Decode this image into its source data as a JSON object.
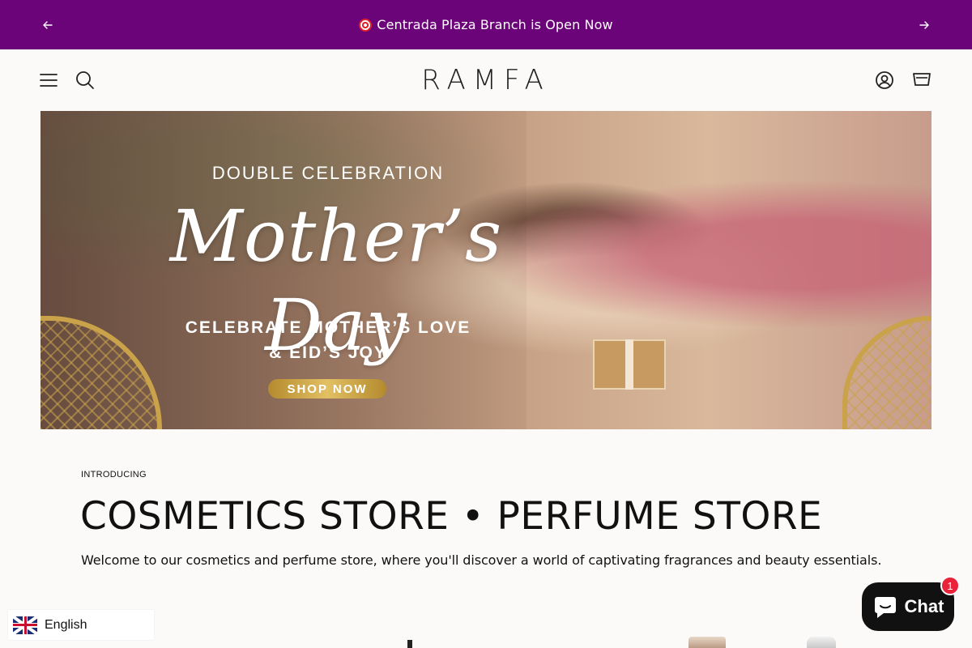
{
  "announcement": {
    "text": "Centrada Plaza Branch is Open Now",
    "icon": "target-emoji"
  },
  "header": {
    "logo": "RAMFA",
    "icons": [
      "menu-icon",
      "search-icon",
      "account-icon",
      "cart-icon"
    ]
  },
  "hero": {
    "kicker": "DOUBLE CELEBRATION",
    "script_title": "Mother’s Day",
    "line1": "CELEBRATE MOTHER’S LOVE",
    "line2": "& EID’S JOY",
    "cta": "SHOP NOW"
  },
  "intro": {
    "kicker": "INTRODUCING",
    "headline": "COSMETICS STORE • PERFUME STORE",
    "description": "Welcome to our cosmetics and perfume store, where you'll discover a world of captivating fragrances and beauty essentials."
  },
  "language": {
    "label": "English"
  },
  "chat": {
    "label": "Chat",
    "badge": "1"
  },
  "colors": {
    "announcement_bg": "#6a0478",
    "chat_bg": "#111111",
    "badge": "#e8233a",
    "gold": "#c9a24a"
  }
}
